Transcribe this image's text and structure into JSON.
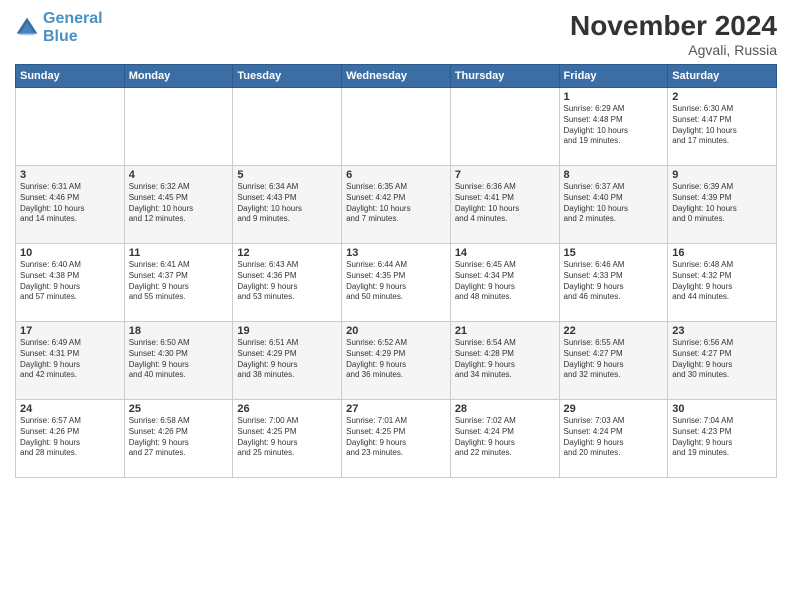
{
  "header": {
    "logo_line1": "General",
    "logo_line2": "Blue",
    "month": "November 2024",
    "location": "Agvali, Russia"
  },
  "days_of_week": [
    "Sunday",
    "Monday",
    "Tuesday",
    "Wednesday",
    "Thursday",
    "Friday",
    "Saturday"
  ],
  "weeks": [
    [
      {
        "day": "",
        "info": ""
      },
      {
        "day": "",
        "info": ""
      },
      {
        "day": "",
        "info": ""
      },
      {
        "day": "",
        "info": ""
      },
      {
        "day": "",
        "info": ""
      },
      {
        "day": "1",
        "info": "Sunrise: 6:29 AM\nSunset: 4:48 PM\nDaylight: 10 hours\nand 19 minutes."
      },
      {
        "day": "2",
        "info": "Sunrise: 6:30 AM\nSunset: 4:47 PM\nDaylight: 10 hours\nand 17 minutes."
      }
    ],
    [
      {
        "day": "3",
        "info": "Sunrise: 6:31 AM\nSunset: 4:46 PM\nDaylight: 10 hours\nand 14 minutes."
      },
      {
        "day": "4",
        "info": "Sunrise: 6:32 AM\nSunset: 4:45 PM\nDaylight: 10 hours\nand 12 minutes."
      },
      {
        "day": "5",
        "info": "Sunrise: 6:34 AM\nSunset: 4:43 PM\nDaylight: 10 hours\nand 9 minutes."
      },
      {
        "day": "6",
        "info": "Sunrise: 6:35 AM\nSunset: 4:42 PM\nDaylight: 10 hours\nand 7 minutes."
      },
      {
        "day": "7",
        "info": "Sunrise: 6:36 AM\nSunset: 4:41 PM\nDaylight: 10 hours\nand 4 minutes."
      },
      {
        "day": "8",
        "info": "Sunrise: 6:37 AM\nSunset: 4:40 PM\nDaylight: 10 hours\nand 2 minutes."
      },
      {
        "day": "9",
        "info": "Sunrise: 6:39 AM\nSunset: 4:39 PM\nDaylight: 10 hours\nand 0 minutes."
      }
    ],
    [
      {
        "day": "10",
        "info": "Sunrise: 6:40 AM\nSunset: 4:38 PM\nDaylight: 9 hours\nand 57 minutes."
      },
      {
        "day": "11",
        "info": "Sunrise: 6:41 AM\nSunset: 4:37 PM\nDaylight: 9 hours\nand 55 minutes."
      },
      {
        "day": "12",
        "info": "Sunrise: 6:43 AM\nSunset: 4:36 PM\nDaylight: 9 hours\nand 53 minutes."
      },
      {
        "day": "13",
        "info": "Sunrise: 6:44 AM\nSunset: 4:35 PM\nDaylight: 9 hours\nand 50 minutes."
      },
      {
        "day": "14",
        "info": "Sunrise: 6:45 AM\nSunset: 4:34 PM\nDaylight: 9 hours\nand 48 minutes."
      },
      {
        "day": "15",
        "info": "Sunrise: 6:46 AM\nSunset: 4:33 PM\nDaylight: 9 hours\nand 46 minutes."
      },
      {
        "day": "16",
        "info": "Sunrise: 6:48 AM\nSunset: 4:32 PM\nDaylight: 9 hours\nand 44 minutes."
      }
    ],
    [
      {
        "day": "17",
        "info": "Sunrise: 6:49 AM\nSunset: 4:31 PM\nDaylight: 9 hours\nand 42 minutes."
      },
      {
        "day": "18",
        "info": "Sunrise: 6:50 AM\nSunset: 4:30 PM\nDaylight: 9 hours\nand 40 minutes."
      },
      {
        "day": "19",
        "info": "Sunrise: 6:51 AM\nSunset: 4:29 PM\nDaylight: 9 hours\nand 38 minutes."
      },
      {
        "day": "20",
        "info": "Sunrise: 6:52 AM\nSunset: 4:29 PM\nDaylight: 9 hours\nand 36 minutes."
      },
      {
        "day": "21",
        "info": "Sunrise: 6:54 AM\nSunset: 4:28 PM\nDaylight: 9 hours\nand 34 minutes."
      },
      {
        "day": "22",
        "info": "Sunrise: 6:55 AM\nSunset: 4:27 PM\nDaylight: 9 hours\nand 32 minutes."
      },
      {
        "day": "23",
        "info": "Sunrise: 6:56 AM\nSunset: 4:27 PM\nDaylight: 9 hours\nand 30 minutes."
      }
    ],
    [
      {
        "day": "24",
        "info": "Sunrise: 6:57 AM\nSunset: 4:26 PM\nDaylight: 9 hours\nand 28 minutes."
      },
      {
        "day": "25",
        "info": "Sunrise: 6:58 AM\nSunset: 4:26 PM\nDaylight: 9 hours\nand 27 minutes."
      },
      {
        "day": "26",
        "info": "Sunrise: 7:00 AM\nSunset: 4:25 PM\nDaylight: 9 hours\nand 25 minutes."
      },
      {
        "day": "27",
        "info": "Sunrise: 7:01 AM\nSunset: 4:25 PM\nDaylight: 9 hours\nand 23 minutes."
      },
      {
        "day": "28",
        "info": "Sunrise: 7:02 AM\nSunset: 4:24 PM\nDaylight: 9 hours\nand 22 minutes."
      },
      {
        "day": "29",
        "info": "Sunrise: 7:03 AM\nSunset: 4:24 PM\nDaylight: 9 hours\nand 20 minutes."
      },
      {
        "day": "30",
        "info": "Sunrise: 7:04 AM\nSunset: 4:23 PM\nDaylight: 9 hours\nand 19 minutes."
      }
    ]
  ]
}
